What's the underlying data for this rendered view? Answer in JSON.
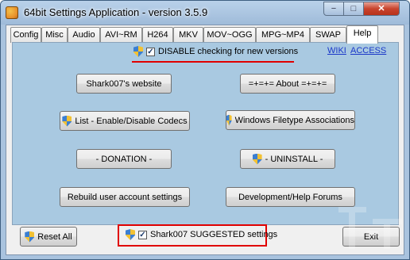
{
  "window": {
    "title": "64bit Settings Application - version 3.5.9",
    "minimize": "−",
    "maximize": "□",
    "close": "✕"
  },
  "tabs": [
    {
      "label": "Config"
    },
    {
      "label": "Misc"
    },
    {
      "label": "Audio"
    },
    {
      "label": "AVI~RM"
    },
    {
      "label": "H264"
    },
    {
      "label": "MKV"
    },
    {
      "label": "MOV~OGG"
    },
    {
      "label": "MPG~MP4"
    },
    {
      "label": "SWAP"
    },
    {
      "label": "Help",
      "active": true
    }
  ],
  "help": {
    "disable_check_label": "DISABLE checking for new versions",
    "disable_checked": true,
    "wiki_link": "WIKI",
    "access_link": "ACCESS",
    "buttons": {
      "website": "Shark007's website",
      "about": "=+=+= About =+=+=",
      "codecs": "List - Enable/Disable Codecs",
      "associations": "Windows Filetype Associations",
      "donation": "- DONATION -",
      "uninstall": "- UNINSTALL -",
      "rebuild": "Rebuild user account settings",
      "forums": "Development/Help Forums"
    }
  },
  "footer": {
    "reset_all": "Reset All",
    "suggested_label": "Shark007 SUGGESTED settings",
    "suggested_checked": true,
    "exit": "Exit"
  },
  "colors": {
    "page_background": "#a9c9e1",
    "highlight_red": "#e00000",
    "link_blue": "#1a37c8"
  }
}
